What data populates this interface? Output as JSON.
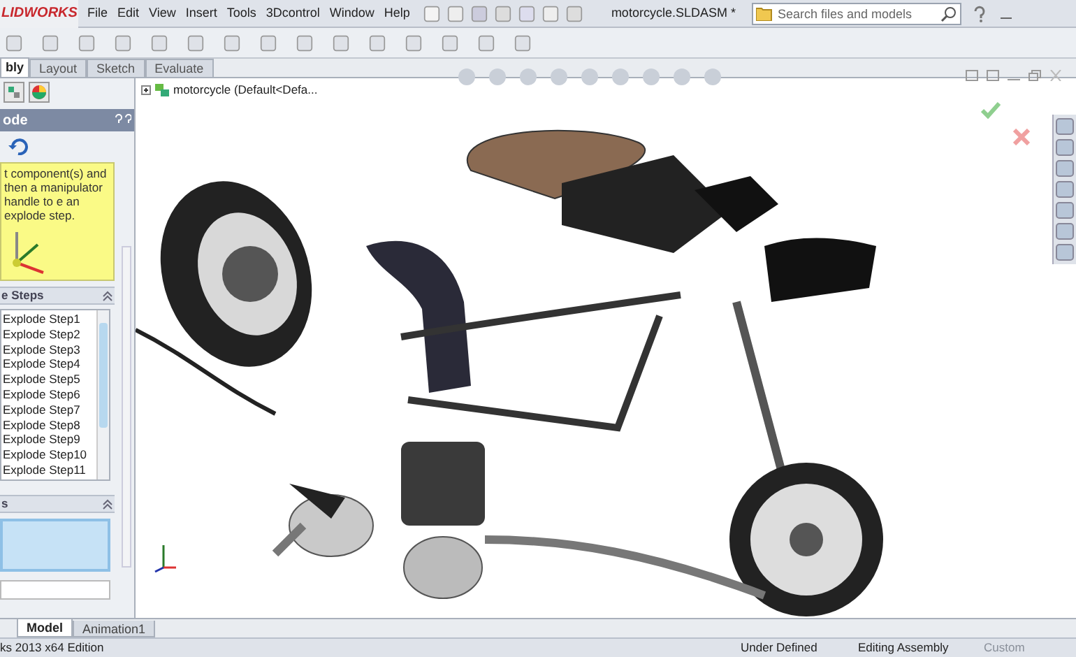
{
  "app": {
    "logo": "LIDWORKS",
    "menus": [
      "File",
      "Edit",
      "View",
      "Insert",
      "Tools",
      "3Dcontrol",
      "Window",
      "Help"
    ],
    "title": "motorcycle.SLDASM *",
    "search": {
      "placeholder": "Search files and models"
    }
  },
  "command_tabs": [
    {
      "label": "bly",
      "selected": true
    },
    {
      "label": "Layout",
      "selected": false
    },
    {
      "label": "Sketch",
      "selected": false
    },
    {
      "label": "Evaluate",
      "selected": false
    }
  ],
  "panel": {
    "title": "ode",
    "message": "t component(s) and then a manipulator handle to e an explode step.",
    "steps_header": "e Steps",
    "steps": [
      "Explode Step1",
      "Explode Step2",
      "Explode Step3",
      "Explode Step4",
      "Explode Step5",
      "Explode Step6",
      "Explode Step7",
      "Explode Step8",
      "Explode Step9",
      "Explode Step10",
      "Explode Step11"
    ],
    "settings_header": "s"
  },
  "tree": {
    "root": "motorcycle  (Default<Defa..."
  },
  "model_tabs": [
    {
      "label": "Model",
      "selected": true
    },
    {
      "label": "Animation1",
      "selected": false
    }
  ],
  "status_bar": {
    "edition": "ks 2013 x64 Edition",
    "state": "Under Defined",
    "mode": "Editing Assembly",
    "units": "Custom"
  }
}
